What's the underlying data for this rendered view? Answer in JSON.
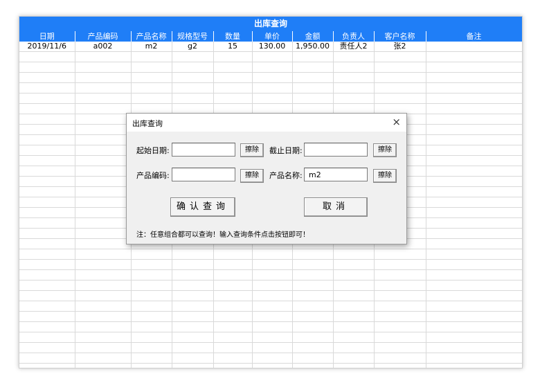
{
  "sheet": {
    "title": "出库查询",
    "columns": [
      "日期",
      "产品编码",
      "产品名称",
      "规格型号",
      "数量",
      "单价",
      "金额",
      "负责人",
      "客户名称",
      "备注"
    ],
    "rows": [
      [
        "2019/11/6",
        "a002",
        "m2",
        "g2",
        "15",
        "130.00",
        "1,950.00",
        "责任人2",
        "张2",
        ""
      ]
    ]
  },
  "dialog": {
    "title": "出库查询",
    "close_label": "×",
    "start_date_label": "起始日期:",
    "start_date_value": "",
    "end_date_label": "截止日期:",
    "end_date_value": "",
    "product_code_label": "产品编码:",
    "product_code_value": "",
    "product_name_label": "产品名称:",
    "product_name_value": "m2",
    "clear_label": "擦除",
    "confirm_label": "确认查询",
    "cancel_label": "取消",
    "note": "注：任意组合都可以查询！输入查询条件点击按钮即可！"
  },
  "colors": {
    "header_blue": "#1f7ef7"
  }
}
